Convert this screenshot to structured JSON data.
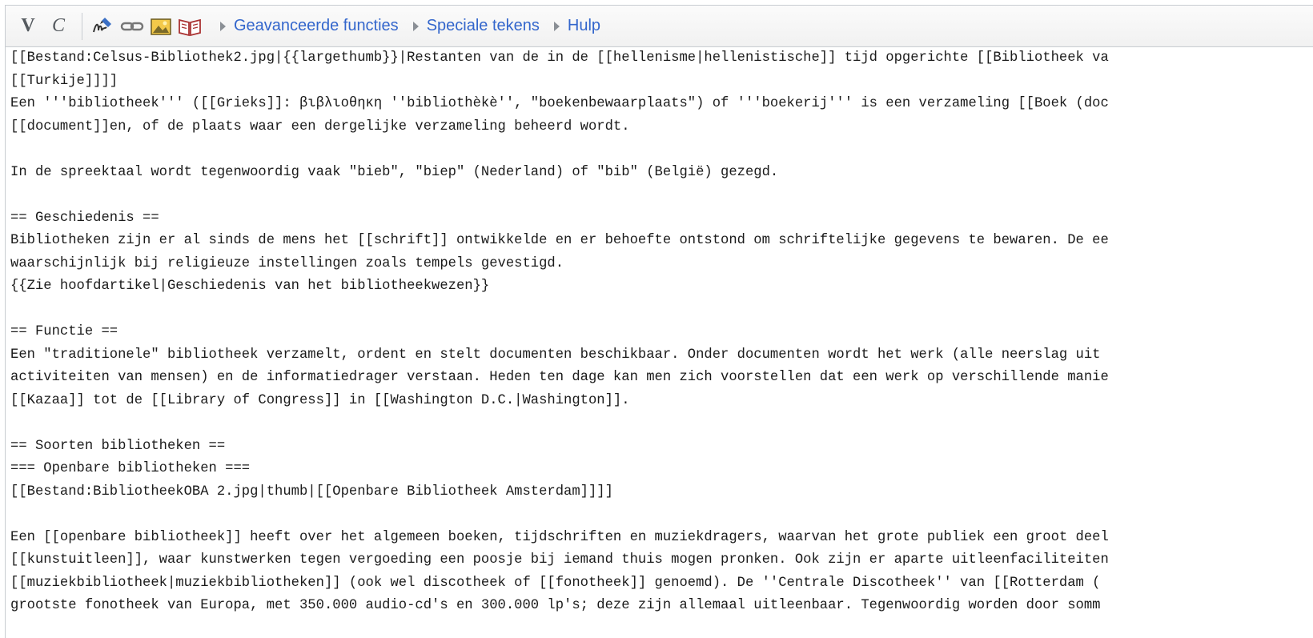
{
  "toolbar": {
    "bold_label": "V",
    "italic_label": "C",
    "tabs": [
      {
        "label": "Geavanceerde functies"
      },
      {
        "label": "Speciale tekens"
      },
      {
        "label": "Hulp"
      }
    ]
  },
  "editor": {
    "lines": [
      "[[Bestand:Celsus-Bibliothek2.jpg|{{largethumb}}|Restanten van de in de [[hellenisme|hellenistische]] tijd opgerichte [[Bibliotheek va",
      "[[Turkije]]]]",
      "Een '''bibliotheek''' ([[Grieks]]: βιβλιοθηκη ''bibliothèkè'', \"boekenbewaarplaats\") of '''boekerij''' is een verzameling [[Boek (doc",
      "[[document]]en, of de plaats waar een dergelijke verzameling beheerd wordt.",
      "",
      "In de spreektaal wordt tegenwoordig vaak \"bieb\", \"biep\" (Nederland) of \"bib\" (België) gezegd.",
      "",
      "== Geschiedenis ==",
      "Bibliotheken zijn er al sinds de mens het [[schrift]] ontwikkelde en er behoefte ontstond om schriftelijke gegevens te bewaren. De ee",
      "waarschijnlijk bij religieuze instellingen zoals tempels gevestigd.",
      "{{Zie hoofdartikel|Geschiedenis van het bibliotheekwezen}}",
      "",
      "== Functie ==",
      "Een \"traditionele\" bibliotheek verzamelt, ordent en stelt documenten beschikbaar. Onder documenten wordt het werk (alle neerslag uit",
      "activiteiten van mensen) en de informatiedrager verstaan. Heden ten dage kan men zich voorstellen dat een werk op verschillende manie",
      "[[Kazaa]] tot de [[Library of Congress]] in [[Washington D.C.|Washington]].",
      "",
      "== Soorten bibliotheken ==",
      "=== Openbare bibliotheken ===",
      "[[Bestand:BibliotheekOBA 2.jpg|thumb|[[Openbare Bibliotheek Amsterdam]]]]",
      "",
      "Een [[openbare bibliotheek]] heeft over het algemeen boeken, tijdschriften en muziekdragers, waarvan het grote publiek een groot deel",
      "[[kunstuitleen]], waar kunstwerken tegen vergoeding een poosje bij iemand thuis mogen pronken. Ook zijn er aparte uitleenfaciliteiten",
      "[[muziekbibliotheek|muziekbibliotheken]] (ook wel discotheek of [[fonotheek]] genoemd). De ''Centrale Discotheek'' van [[Rotterdam (",
      "grootste fonotheek van Europa, met 350.000 audio-cd's en 300.000 lp's; deze zijn allemaal uitleenbaar. Tegenwoordig worden door somm"
    ]
  }
}
